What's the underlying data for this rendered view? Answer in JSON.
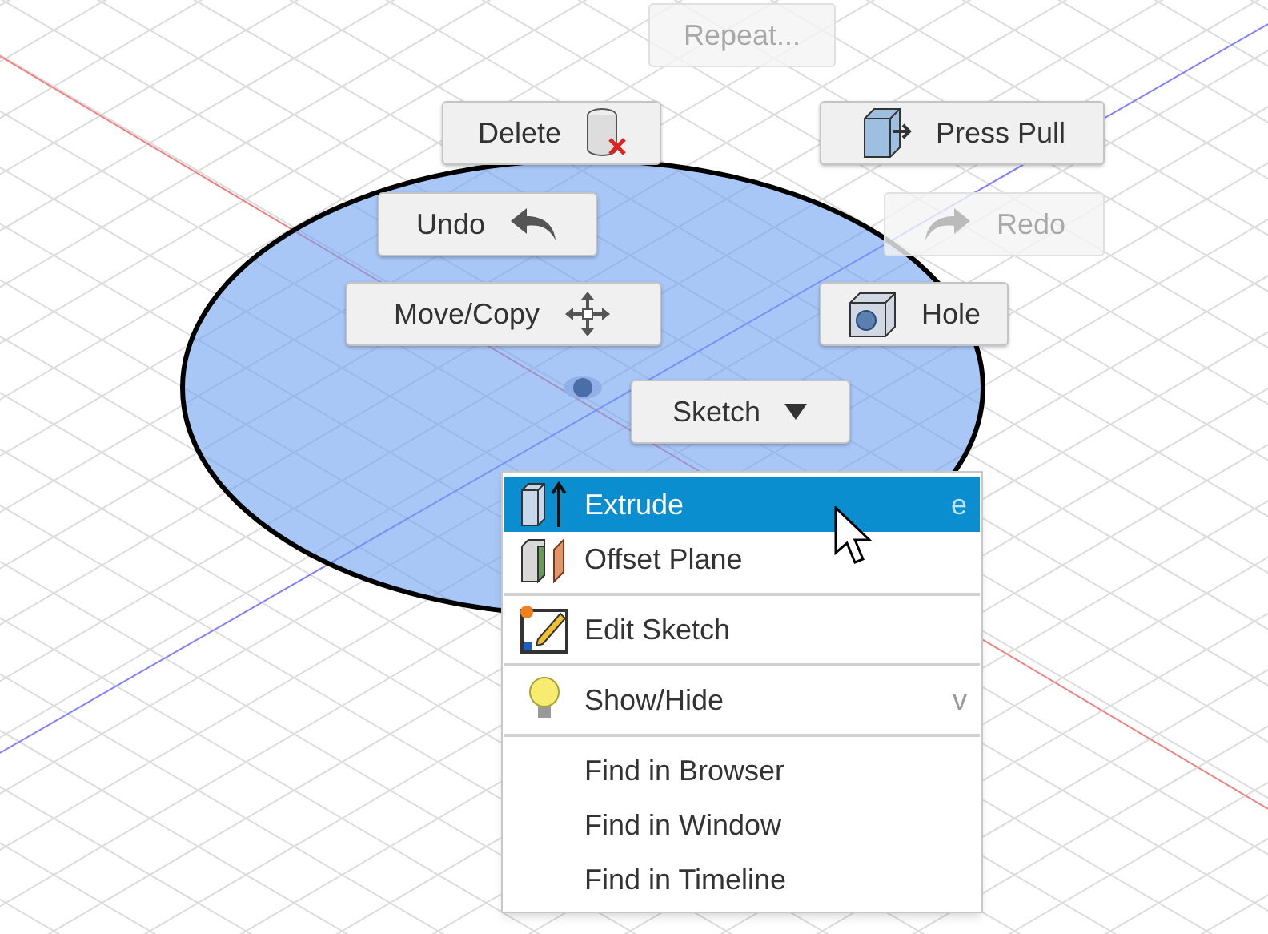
{
  "marking_menu": {
    "buttons": [
      {
        "label": "Repeat...",
        "disabled": true
      },
      {
        "label": "Delete",
        "disabled": false
      },
      {
        "label": "Press Pull",
        "disabled": false
      },
      {
        "label": "Undo",
        "disabled": false
      },
      {
        "label": "Redo",
        "disabled": true
      },
      {
        "label": "Move/Copy",
        "disabled": false
      },
      {
        "label": "Hole",
        "disabled": false
      },
      {
        "label": "Sketch",
        "disabled": false
      }
    ]
  },
  "context_menu": {
    "groups": [
      [
        {
          "label": "Extrude",
          "shortcut": "e",
          "selected": true
        },
        {
          "label": "Offset Plane",
          "selected": false
        }
      ],
      [
        {
          "label": "Edit Sketch",
          "selected": false
        }
      ],
      [
        {
          "label": "Show/Hide",
          "shortcut": "v",
          "selected": false
        }
      ],
      [
        {
          "label": "Find in Browser",
          "selected": false
        },
        {
          "label": "Find in Window",
          "selected": false
        },
        {
          "label": "Find in Timeline",
          "selected": false
        }
      ]
    ]
  }
}
